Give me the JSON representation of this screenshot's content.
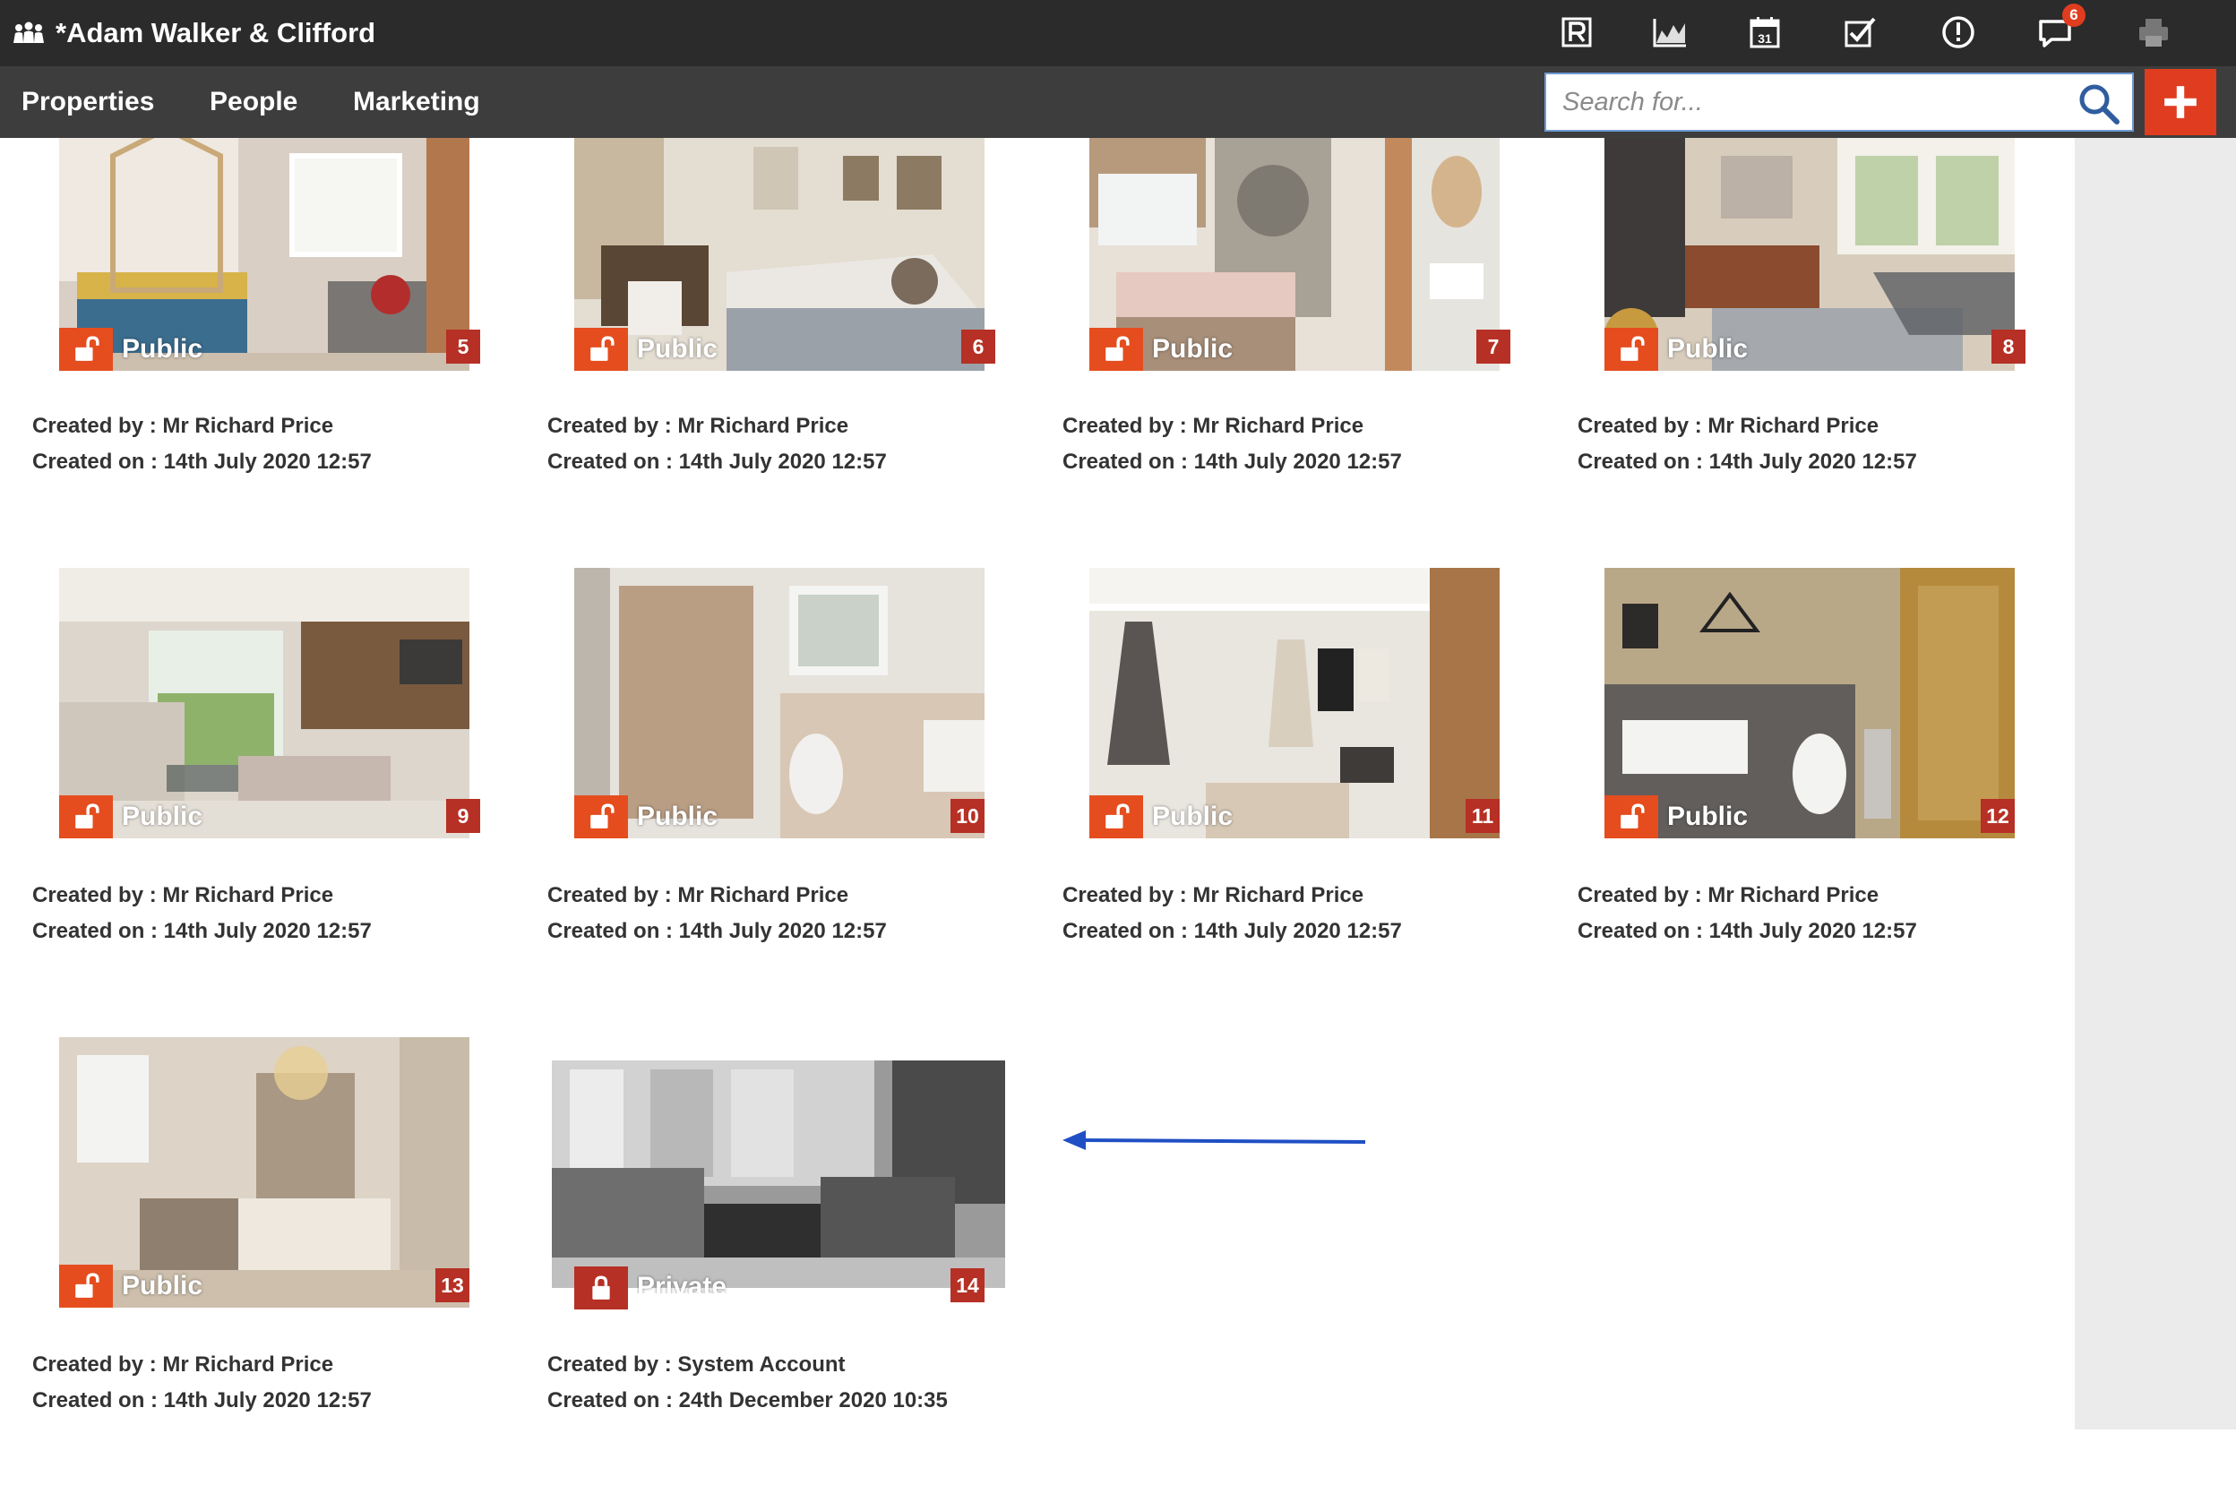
{
  "app": {
    "title": "*Adam Walker & Clifford"
  },
  "topbar": {
    "icons": [
      {
        "name": "r-logo-icon"
      },
      {
        "name": "chart-icon"
      },
      {
        "name": "calendar-icon",
        "label": "31"
      },
      {
        "name": "checkbox-icon"
      },
      {
        "name": "alert-icon"
      },
      {
        "name": "messages-icon",
        "badge": "6"
      },
      {
        "name": "printer-icon"
      }
    ]
  },
  "nav": {
    "items": [
      {
        "label": "Properties"
      },
      {
        "label": "People"
      },
      {
        "label": "Marketing"
      }
    ]
  },
  "search": {
    "placeholder": "Search for..."
  },
  "colors": {
    "accent": "#e03c1f",
    "topbar": "#2b2b2b",
    "navbar": "#3d3d3d",
    "badge": "#b63025",
    "arrow": "#1f4fc4"
  },
  "photos": [
    {
      "number": "5",
      "visibility": "Public",
      "created_by": "Created by : Mr Richard Price",
      "created_on": "Created on : 14th July 2020 12:57"
    },
    {
      "number": "6",
      "visibility": "Public",
      "created_by": "Created by : Mr Richard Price",
      "created_on": "Created on : 14th July 2020 12:57"
    },
    {
      "number": "7",
      "visibility": "Public",
      "created_by": "Created by : Mr Richard Price",
      "created_on": "Created on : 14th July 2020 12:57"
    },
    {
      "number": "8",
      "visibility": "Public",
      "created_by": "Created by : Mr Richard Price",
      "created_on": "Created on : 14th July 2020 12:57"
    },
    {
      "number": "9",
      "visibility": "Public",
      "created_by": "Created by : Mr Richard Price",
      "created_on": "Created on : 14th July 2020 12:57"
    },
    {
      "number": "10",
      "visibility": "Public",
      "created_by": "Created by : Mr Richard Price",
      "created_on": "Created on : 14th July 2020 12:57"
    },
    {
      "number": "11",
      "visibility": "Public",
      "created_by": "Created by : Mr Richard Price",
      "created_on": "Created on : 14th July 2020 12:57"
    },
    {
      "number": "12",
      "visibility": "Public",
      "created_by": "Created by : Mr Richard Price",
      "created_on": "Created on : 14th July 2020 12:57"
    },
    {
      "number": "13",
      "visibility": "Public",
      "created_by": "Created by : Mr Richard Price",
      "created_on": "Created on : 14th July 2020 12:57"
    },
    {
      "number": "14",
      "visibility": "Private",
      "created_by": "Created by : System Account",
      "created_on": "Created on : 24th December 2020 10:35"
    }
  ]
}
